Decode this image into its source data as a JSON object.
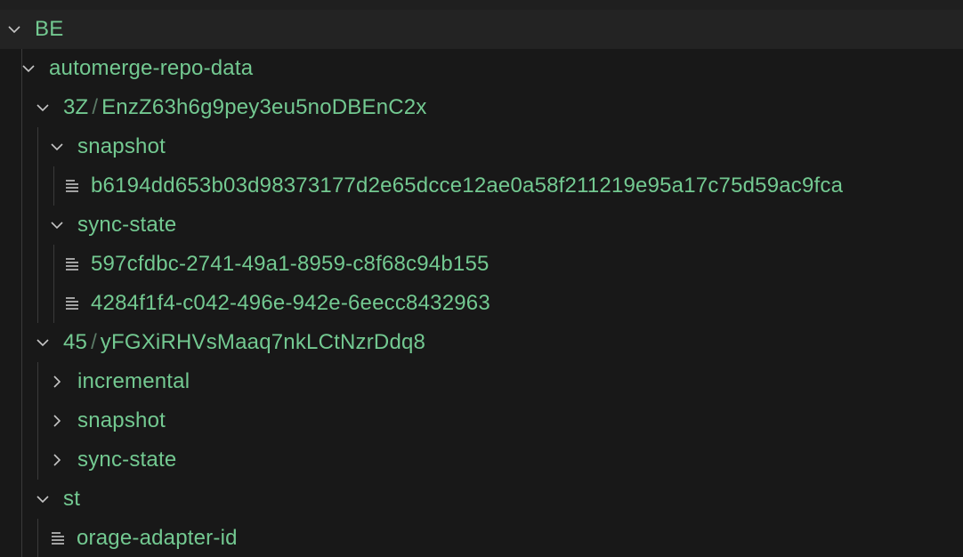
{
  "tree": {
    "root": "BE",
    "repo_folder": "automerge-repo-data",
    "doc1": {
      "prefix": "3Z",
      "separator": "/",
      "name": "EnzZ63h6g9pey3eu5noDBEnC2x"
    },
    "doc1_snapshot": "snapshot",
    "doc1_snapshot_file": "b6194dd653b03d98373177d2e65dcce12ae0a58f211219e95a17c75d59ac9fca",
    "doc1_sync_state": "sync-state",
    "doc1_sync_file_1": "597cfdbc-2741-49a1-8959-c8f68c94b155",
    "doc1_sync_file_2": "4284f1f4-c042-496e-942e-6eecc8432963",
    "doc2": {
      "prefix": "45",
      "separator": "/",
      "name": "yFGXiRHVsMaaq7nkLCtNzrDdq8"
    },
    "doc2_incremental": "incremental",
    "doc2_snapshot": "snapshot",
    "doc2_sync_state": "sync-state",
    "st_folder": "st",
    "st_file": "orage-adapter-id"
  },
  "colors": {
    "background": "#181818",
    "selected_row": "#232323",
    "label_green": "#73c991",
    "chevron": "#c5c5c5",
    "guide_line": "#3a3a3a"
  },
  "icons": {
    "expanded": "chevron-down-icon",
    "collapsed": "chevron-right-icon",
    "file": "file-lines-icon"
  }
}
